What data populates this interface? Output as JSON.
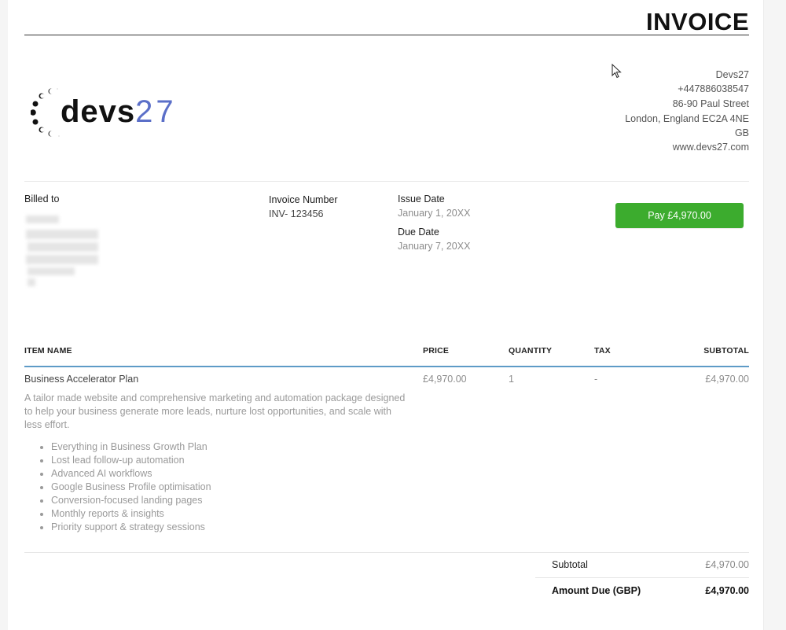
{
  "invoice": {
    "title": "INVOICE",
    "logo": {
      "word": "devs",
      "number": "27"
    },
    "company": {
      "name": "Devs27",
      "phone": "+447886038547",
      "street": "86-90 Paul Street",
      "city": "London, England EC2A 4NE",
      "country": "GB",
      "website": "www.devs27.com"
    },
    "billed_to_label": "Billed to",
    "invoice_number_label": "Invoice Number",
    "invoice_number": "INV- 123456",
    "issue_date_label": "Issue Date",
    "issue_date": "January 1, 20XX",
    "due_date_label": "Due Date",
    "due_date": "January 7, 20XX",
    "pay_button": "Pay £4,970.00",
    "columns": {
      "item_name": "ITEM NAME",
      "price": "PRICE",
      "quantity": "QUANTITY",
      "tax": "TAX",
      "subtotal": "SUBTOTAL"
    },
    "item": {
      "name": "Business Accelerator Plan",
      "price": "£4,970.00",
      "quantity": "1",
      "tax": "-",
      "subtotal": "£4,970.00",
      "description": "A tailor made website and comprehensive marketing and automation package designed to help your business generate more leads, nurture lost opportunities, and scale with less effort.",
      "features": [
        "Everything in Business Growth Plan",
        "Lost lead follow-up automation",
        "Advanced AI workflows",
        "Google Business Profile optimisation",
        "Conversion-focused landing pages",
        "Monthly reports & insights",
        "Priority support & strategy sessions"
      ]
    },
    "totals": {
      "subtotal_label": "Subtotal",
      "subtotal": "£4,970.00",
      "amount_due_label": "Amount Due (GBP)",
      "amount_due": "£4,970.00"
    }
  },
  "colors": {
    "pay_button": "#3cac2e",
    "header_rule": "#5e9bc7",
    "logo_accent": "#5b6fc8"
  }
}
